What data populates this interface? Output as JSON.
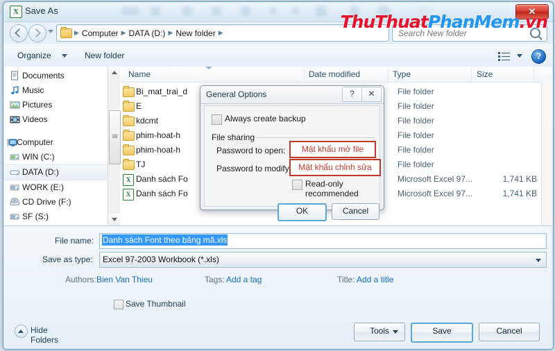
{
  "window": {
    "title": "Save As",
    "app_icon": "excel-icon",
    "close_label": "✕"
  },
  "watermark": {
    "part1": "ThuThuat",
    "part2": "PhanMem",
    "part3": ".vn",
    "color_red": "#e8112d",
    "color_blue": "#2196f3"
  },
  "nav": {
    "breadcrumbs": [
      "Computer",
      "DATA (D:)",
      "New folder"
    ],
    "separator": "▶",
    "search_placeholder": "Search New folder",
    "search_value": ""
  },
  "toolbar": {
    "organize": "Organize",
    "new_folder": "New folder"
  },
  "sidebar": {
    "items": [
      {
        "label": "Documents",
        "icon": "document-icon",
        "selected": false,
        "root": false
      },
      {
        "label": "Music",
        "icon": "music-icon",
        "selected": false,
        "root": false
      },
      {
        "label": "Pictures",
        "icon": "picture-icon",
        "selected": false,
        "root": false
      },
      {
        "label": "Videos",
        "icon": "video-icon",
        "selected": false,
        "root": false
      },
      {
        "label": "Computer",
        "icon": "computer-icon",
        "selected": false,
        "root": true
      },
      {
        "label": "WIN (C:)",
        "icon": "drive-icon",
        "selected": false,
        "root": false
      },
      {
        "label": "DATA (D:)",
        "icon": "drive-icon",
        "selected": true,
        "root": false
      },
      {
        "label": "WORK (E:)",
        "icon": "drive-icon",
        "selected": false,
        "root": false
      },
      {
        "label": "CD Drive (F:)",
        "icon": "cd-drive-icon",
        "selected": false,
        "root": false
      },
      {
        "label": "SF (S:)",
        "icon": "drive-icon",
        "selected": false,
        "root": false
      }
    ]
  },
  "filelist": {
    "columns": [
      "Name",
      "Date modified",
      "Type",
      "Size"
    ],
    "rows": [
      {
        "name": "Bi_mat_trai_d",
        "type": "File folder",
        "size": "",
        "icon": "folder-icon"
      },
      {
        "name": "E",
        "type": "File folder",
        "size": "",
        "icon": "folder-icon"
      },
      {
        "name": "kdcmt",
        "type": "File folder",
        "size": "",
        "icon": "folder-icon"
      },
      {
        "name": "phim-hoat-h",
        "type": "File folder",
        "size": "",
        "icon": "folder-icon"
      },
      {
        "name": "phim-hoat-h",
        "type": "File folder",
        "size": "",
        "icon": "folder-icon"
      },
      {
        "name": "TJ",
        "type": "File folder",
        "size": "",
        "icon": "folder-icon"
      },
      {
        "name": "Danh sách Fo",
        "type": "Microsoft Excel 97...",
        "size": "1,741 KB",
        "icon": "excel-file-icon"
      },
      {
        "name": "Danh sách Fo",
        "type": "Microsoft Excel 97...",
        "size": "1,741 KB",
        "icon": "excel-file-icon"
      }
    ]
  },
  "form": {
    "file_name_label": "File name:",
    "file_name_value": "Danh sách Font theo bảng mã.xls",
    "save_type_label": "Save as type:",
    "save_type_value": "Excel 97-2003 Workbook (*.xls)",
    "authors_label": "Authors:",
    "authors_value": "Bien Van Thieu",
    "tags_label": "Tags:",
    "tags_value": "Add a tag",
    "title_label": "Title:",
    "title_value": "Add a title",
    "save_thumbnail": "Save Thumbnail",
    "hide_folders": "Hide Folders",
    "tools_button": "Tools",
    "save_button": "Save",
    "cancel_button": "Cancel"
  },
  "dialog": {
    "title": "General Options",
    "help_glyph": "?",
    "close_glyph": "✕",
    "always_create_backup": "Always create backup",
    "file_sharing": "File sharing",
    "password_open_label": "Password to open:",
    "password_open_value": "Mật khẩu mở file",
    "password_modify_label": "Password to modify:",
    "password_modify_value": "Mật khẩu chỉnh sửa",
    "read_only": "Read-only recommended",
    "ok_button": "OK",
    "cancel_button": "Cancel",
    "highlight_color": "#c0392b"
  }
}
